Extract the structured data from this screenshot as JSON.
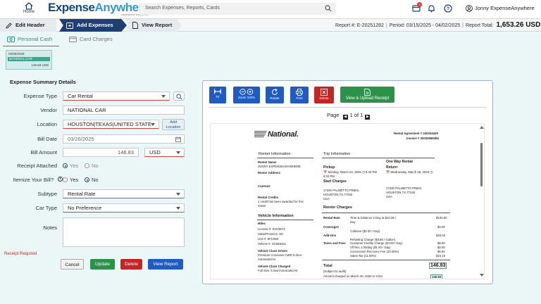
{
  "app": {
    "home_label": "Home",
    "logo_part1": "Expense",
    "logo_part2": "Anywhere",
    "logo_tagline": "experience excellence",
    "search_placeholder": "Search Expenses, Reports, Cards",
    "notification_count": "2",
    "user_name": "Jonny ExpenseAnywhere"
  },
  "nav": {
    "edit_header": "Edit Header",
    "add_expenses": "Add Expenses",
    "view_report": "View Report",
    "report_number": "Report #: E-20251282",
    "period": "Period: 03/15/2025 - 04/02/2025",
    "report_total_label": "Report Total:",
    "report_total_value": "1,653.26 USD"
  },
  "subtabs": {
    "personal_cash": "Personal Cash",
    "card_charges": "Card Charges"
  },
  "thumbnail": {
    "date": "03/26/2025",
    "vendor": "NATIONAL CAR",
    "amount": "146.83 USD"
  },
  "form": {
    "section_title": "Expense Summary Details",
    "expense_type_label": "Expense Type",
    "expense_type_value": "Car Rental",
    "vendor_label": "Vendor",
    "vendor_value": "NATIONAL CAR",
    "location_label": "Location",
    "location_value": "HOUSTON|TEXAS|UNITED STATE",
    "add_location_line1": "Add",
    "add_location_line2": "Location",
    "bill_date_label": "Bill Date",
    "bill_date_value": "03/26/2025",
    "bill_amount_label": "Bill Amount",
    "bill_amount_value": "146.83",
    "currency_value": "USD",
    "receipt_attached_label": "Receipt Attached",
    "receipt_yes": "Yes",
    "receipt_no": "No",
    "itemize_label": "Itemize Your Bill?",
    "itemize_yes": "Yes",
    "itemize_no": "No",
    "subtype_label": "Subtype",
    "subtype_value": "Rental Rate",
    "car_type_label": "Car Type",
    "car_type_value": "No Preference",
    "notes_label": "Notes",
    "receipt_required": "Receipt Required",
    "cancel": "Cancel",
    "update": "Update",
    "delete": "Delete",
    "view_report": "View Report"
  },
  "viewer": {
    "fit": "Fit",
    "zoom": "Zoom 100%",
    "rotate": "Rotate",
    "print": "Print",
    "delete": "Delete",
    "upload": "View & Upload Receipt",
    "page_label": "Page",
    "page_of": "1 of 1"
  },
  "receipt": {
    "brand": "National.",
    "agreement": "Rental Agreement # 240334425",
    "invoice": "Invoice # 30032669484",
    "renter_info": "Renter Information",
    "trip_info": "Trip Information",
    "renter_name_label": "Renter Name",
    "renter_name": "JONNY EXPENSEANYWHERE",
    "renter_address_label": "Renter Address",
    "contract_label": "Contract",
    "rental_credits_label": "Rental Credits",
    "rental_credits_text1": "1 credit has been awarded for this",
    "rental_credits_text2": "rental",
    "one_way": "One Way Rental",
    "pickup": "Pickup",
    "pickup_date": "Monday, March 24, 2025",
    "pickup_time": "6:03 PM",
    "pickup_time2": "9:43 PM",
    "return": "Return",
    "return_date": "Wednesday, March 26, 2025",
    "start_charges": "Start Charges",
    "pickup_addr1": "17330 PALMETTO PINES,",
    "pickup_addr2": "HOUSTON,TX,77032",
    "pickup_addr3": "USA",
    "return_addr1": "17330 PALMETTO PINES,",
    "return_addr2": "HOUSTON,TX,77032",
    "return_addr3": "USA",
    "vehicle_info": "Vehicle Information",
    "miles": "Miles",
    "license": "License #: RJV3973",
    "state": "State/Province: NC",
    "unit": "Unit #: 8FC068",
    "vehicle": "Vehicle #: SC059151",
    "class_driven_label": "Vehicle Class Driven",
    "class_driven": "Premium Crossover AWD 5 door",
    "automatic1": "Automatic/Air",
    "class_charged_label": "Vehicle Class Charged",
    "class_charged": "Full Size 4 door/Automatic/Air",
    "renter_charges": "Renter Charges",
    "rental_rate_label": "Rental Rate",
    "rental_rate_desc": "Time & Distance  2  Day at $10.00  /",
    "rental_rate_desc2": "Day",
    "rental_rate_amt": "$100.00",
    "coverages_label": "Coverages",
    "coverages_amt": "$4.00",
    "collision_desc": "Collision ($2.00 / Day)",
    "addons_label": "Add-Ons",
    "addons_amt": "$15.62",
    "refueling_desc": "Refueling Charge ($3.66 / Gallon)",
    "taxes_label": "Taxes and Fees",
    "facility_desc": "Customer Facility Charge ($4.00 / Day)",
    "facility_amt": "$8.00",
    "vlf_desc": "Vlf Rec 1.00/day ($1.00 / Day)",
    "vlf_amt": "$2.00",
    "concession_desc": "Concession Recovery Fee (10.00%)",
    "concession_amt": "$6.91",
    "sales_desc": "Sales Tax (11.00%)",
    "sales_amt": "$10.10",
    "total_label": "Total",
    "total_amt": "146.83",
    "subject_audit": "(Subject to audit)",
    "amount_charged": "Amount charged on March 26, 2025 to VISA",
    "amount_charged_val": "146.83"
  }
}
